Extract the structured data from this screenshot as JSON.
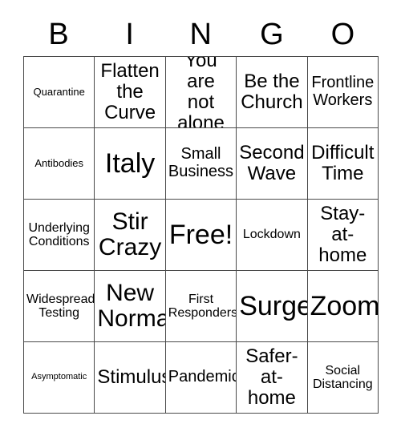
{
  "card": {
    "title": "BINGO",
    "header_letters": [
      "B",
      "I",
      "N",
      "G",
      "O"
    ],
    "colors": {
      "background": "#ffffff",
      "text": "#000000",
      "border": "#4a4a4a"
    },
    "grid_size": "5x5",
    "free_space": "Free!",
    "cells": [
      {
        "text": "Quarantine",
        "size": "sz-xs",
        "row": 1,
        "col": 1
      },
      {
        "text": "Flatten\nthe\nCurve",
        "size": "sz-lg",
        "row": 1,
        "col": 2
      },
      {
        "text": "You are\nnot\nalone",
        "size": "sz-lg",
        "row": 1,
        "col": 3
      },
      {
        "text": "Be the\nChurch",
        "size": "sz-lg",
        "row": 1,
        "col": 4
      },
      {
        "text": "Frontline\nWorkers",
        "size": "sz-md",
        "row": 1,
        "col": 5
      },
      {
        "text": "Antibodies",
        "size": "sz-xs",
        "row": 2,
        "col": 1
      },
      {
        "text": "Italy",
        "size": "sz-xxl",
        "row": 2,
        "col": 2
      },
      {
        "text": "Small\nBusiness",
        "size": "sz-md",
        "row": 2,
        "col": 3
      },
      {
        "text": "Second\nWave",
        "size": "sz-lg",
        "row": 2,
        "col": 4
      },
      {
        "text": "Difficult\nTime",
        "size": "sz-lg",
        "row": 2,
        "col": 5
      },
      {
        "text": "Underlying\nConditions",
        "size": "sz-sm",
        "row": 3,
        "col": 1
      },
      {
        "text": "Stir\nCrazy",
        "size": "sz-xl",
        "row": 3,
        "col": 2
      },
      {
        "text": "Free!",
        "size": "sz-xxl",
        "row": 3,
        "col": 3
      },
      {
        "text": "Lockdown",
        "size": "sz-sm",
        "row": 3,
        "col": 4
      },
      {
        "text": "Stay-\nat-\nhome",
        "size": "sz-lg",
        "row": 3,
        "col": 5
      },
      {
        "text": "Widespread\nTesting",
        "size": "sz-sm",
        "row": 4,
        "col": 1
      },
      {
        "text": "New\nNormal",
        "size": "sz-xl",
        "row": 4,
        "col": 2
      },
      {
        "text": "First\nResponders",
        "size": "sz-sm",
        "row": 4,
        "col": 3
      },
      {
        "text": "Surge",
        "size": "sz-xxl",
        "row": 4,
        "col": 4
      },
      {
        "text": "Zoom",
        "size": "sz-xxl",
        "row": 4,
        "col": 5
      },
      {
        "text": "Asymptomatic",
        "size": "sz-xxs",
        "row": 5,
        "col": 1
      },
      {
        "text": "Stimulus",
        "size": "sz-lg",
        "row": 5,
        "col": 2
      },
      {
        "text": "Pandemic",
        "size": "sz-md",
        "row": 5,
        "col": 3
      },
      {
        "text": "Safer-\nat-\nhome",
        "size": "sz-lg",
        "row": 5,
        "col": 4
      },
      {
        "text": "Social\nDistancing",
        "size": "sz-sm",
        "row": 5,
        "col": 5
      }
    ]
  }
}
